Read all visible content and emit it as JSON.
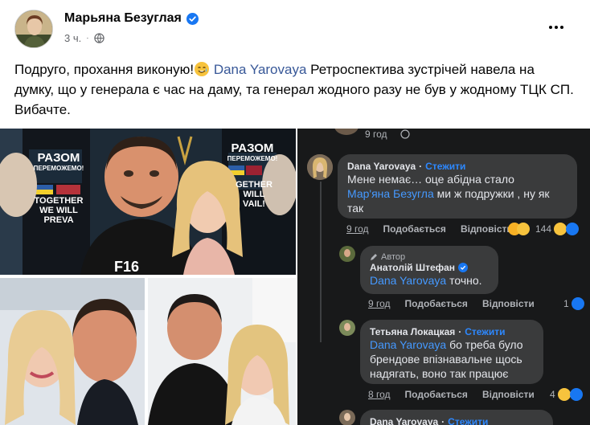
{
  "post": {
    "author": "Марьяна Безуглая",
    "time": "3 ч.",
    "text_before": "Подруго, прохання виконую!",
    "mention": "Dana  Yarovaya",
    "text_after": " Ретроспектива зустрічей навела на думку, що у генерала є час на даму, та генерал жодного разу не був у жодному ТЦК СП. Вибачте."
  },
  "icons": {
    "verified": "verified-badge-icon",
    "privacy": "globe-icon",
    "more": "more-options-icon",
    "emoji": "smiling-with-tear-emoji"
  },
  "photos": {
    "banner_line1": "РАЗОМ",
    "banner_line2": "ПЕРЕМОЖЕМО!",
    "banner_line3": "TOGETHER",
    "banner_line4": "WE WILL",
    "banner_line5": "PREVA",
    "banner_right1": "РАЗОМ",
    "banner_right2": "ПЕРЕМОЖЕМО!",
    "banner_right3": "GETHER",
    "banner_right4": "WILL",
    "banner_right5": "VAIL!",
    "shirt": "F16"
  },
  "comments": {
    "top_time": "9 год",
    "c1": {
      "name": "Dana Yarovaya",
      "follow": "Стежити",
      "line1": "Мене немає… оце абідна стало",
      "mention": "Мар'яна Безугла",
      "line2_rest": " ми ж подружки , ну як",
      "line3": "так",
      "time": "9 год",
      "like": "Подобається",
      "reply": "Відповісти",
      "count": "144"
    },
    "c2": {
      "badge": "Автор",
      "name": "Анатолій Штефан",
      "mention": "Dana  Yarovaya",
      "text": " точно.",
      "time": "9 год",
      "like": "Подобається",
      "reply": "Відповісти",
      "count": "1"
    },
    "c3": {
      "name": "Тетьяна Локацкая",
      "follow": "Стежити",
      "mention": "Dana  Yarovaya",
      "line1_rest": " бо треба було",
      "line2": "брендове впізнавальне щось",
      "line3": "надягать, воно так працює",
      "time": "8 год",
      "like": "Подобається",
      "reply": "Відповісти",
      "count": "4"
    },
    "c4": {
      "name": "Dana  Yarovaya",
      "follow": "Стежити"
    }
  },
  "colors": {
    "accent_link": "#385898",
    "dark_bg": "#18191a",
    "bubble": "#3a3b3c",
    "dark_link": "#4599ff",
    "verified_blue": "#1877f2"
  }
}
